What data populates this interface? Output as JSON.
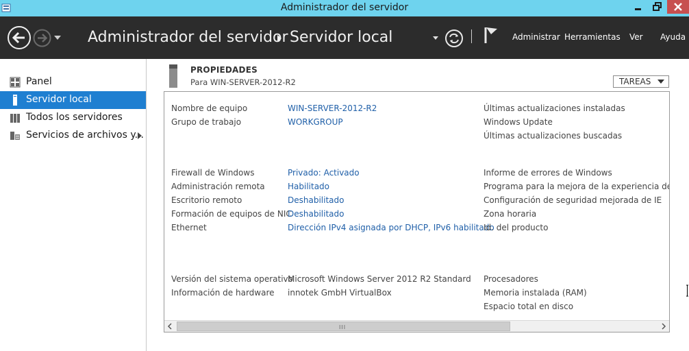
{
  "window": {
    "title": "Administrador del servidor",
    "buttons": {
      "minimize": "minimize-icon",
      "maximize": "restore-icon",
      "close": "close-icon"
    }
  },
  "header": {
    "breadcrumb": [
      "Administrador del servidor",
      "Servidor local"
    ],
    "menu": [
      "Administrar",
      "Herramientas",
      "Ver",
      "Ayuda"
    ]
  },
  "sidebar": {
    "items": [
      {
        "label": "Panel",
        "icon": "dashboard-icon",
        "active": false
      },
      {
        "label": "Servidor local",
        "icon": "local-server-icon",
        "active": true
      },
      {
        "label": "Todos los servidores",
        "icon": "all-servers-icon",
        "active": false
      },
      {
        "label": "Servicios de archivos y...",
        "icon": "file-services-icon",
        "active": false
      }
    ]
  },
  "properties": {
    "title": "PROPIEDADES",
    "subtitle": "Para WIN-SERVER-2012-R2",
    "tasks_label": "TAREAS",
    "group1": {
      "rows": [
        {
          "label": "Nombre de equipo",
          "value": "WIN-SERVER-2012-R2"
        },
        {
          "label": "Grupo de trabajo",
          "value": "WORKGROUP"
        }
      ],
      "right": [
        "Últimas actualizaciones instaladas",
        "Windows Update",
        "Últimas actualizaciones buscadas"
      ]
    },
    "group2": {
      "rows": [
        {
          "label": "Firewall de Windows",
          "value": "Privado: Activado"
        },
        {
          "label": "Administración remota",
          "value": "Habilitado"
        },
        {
          "label": "Escritorio remoto",
          "value": "Deshabilitado"
        },
        {
          "label": "Formación de equipos de NIC",
          "value": "Deshabilitado"
        },
        {
          "label": "Ethernet",
          "value": "Dirección IPv4 asignada por DHCP, IPv6 habilitado"
        }
      ],
      "right": [
        "Informe de errores de Windows",
        "Programa para la mejora de la experiencia del usua",
        "Configuración de seguridad mejorada de IE",
        "Zona horaria",
        "Id. del producto"
      ]
    },
    "group3": {
      "rows": [
        {
          "label": "Versión del sistema operativo",
          "value": "Microsoft Windows Server 2012 R2 Standard"
        },
        {
          "label": "Información de hardware",
          "value": "innotek GmbH VirtualBox"
        }
      ],
      "right": [
        "Procesadores",
        "Memoria instalada (RAM)",
        "Espacio total en disco"
      ]
    },
    "scroll_grip": "III"
  },
  "colors": {
    "titlebar": "#6ed3ee",
    "header": "#2c2c2c",
    "active_nav": "#1f7fd1",
    "link": "#1f5fa8",
    "close_button": "#c75050"
  }
}
